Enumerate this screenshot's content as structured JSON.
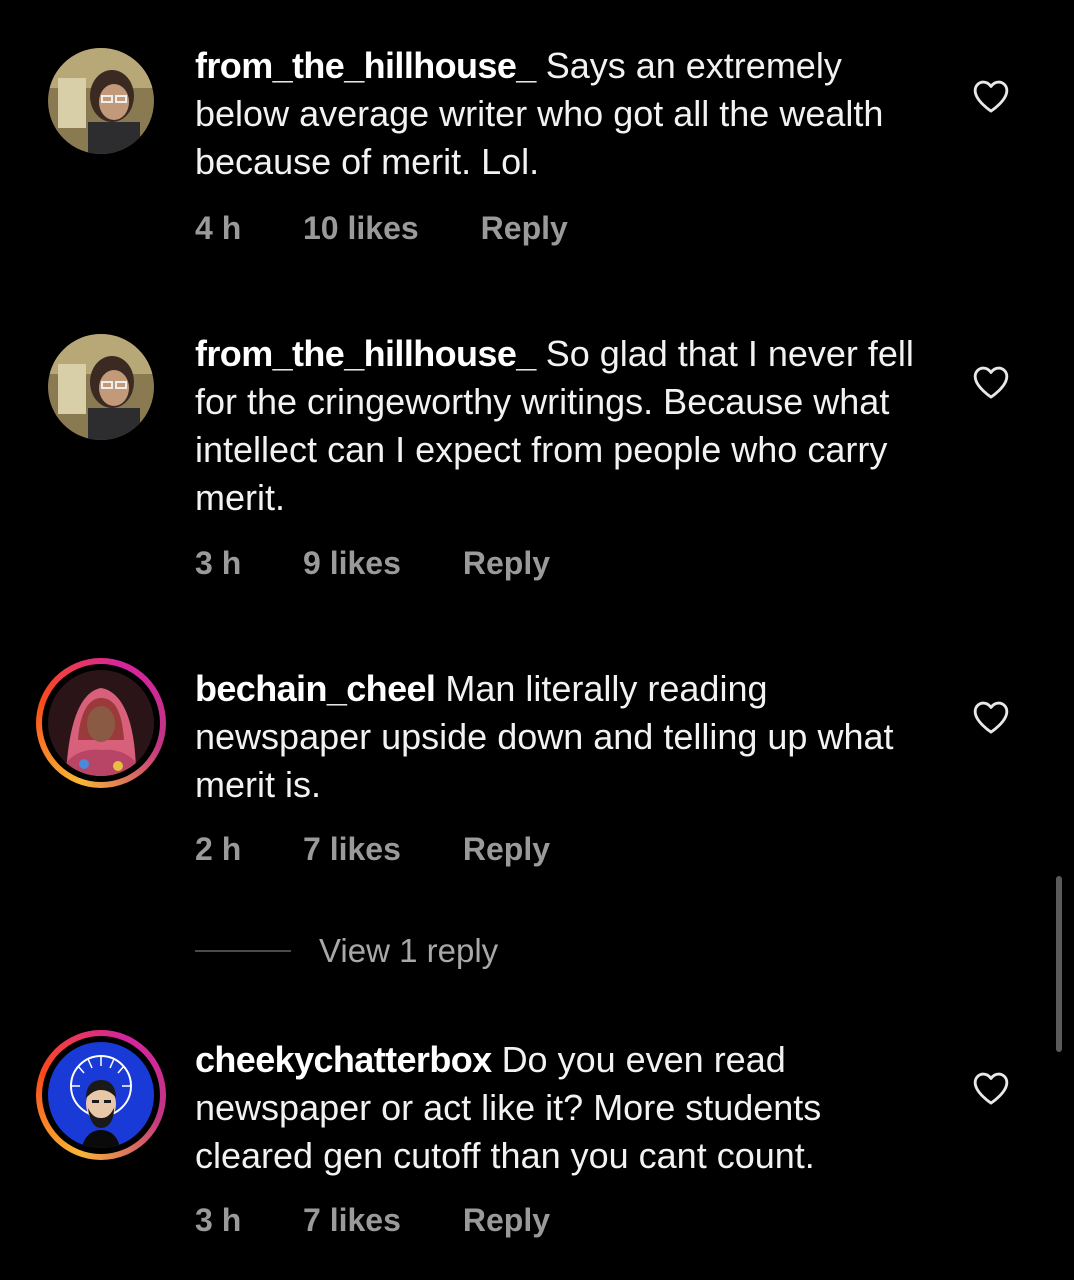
{
  "comments": [
    {
      "username": "from_the_hillhouse_",
      "text": "Says an extremely below average writer who got all the wealth because of merit. Lol.",
      "time": "4 h",
      "likes": "10 likes",
      "reply": "Reply",
      "has_story": false
    },
    {
      "username": "from_the_hillhouse_",
      "text": "So glad that I never fell for the cringeworthy writings. Because what intellect can I expect from people who carry merit.",
      "time": "3 h",
      "likes": "9 likes",
      "reply": "Reply",
      "has_story": false
    },
    {
      "username": "bechain_cheel",
      "text": "Man literally reading newspaper upside down and telling up what merit is.",
      "time": "2 h",
      "likes": "7 likes",
      "reply": "Reply",
      "has_story": true
    },
    {
      "username": "cheekychatterbox",
      "text": "Do you even read newspaper or act like it? More students cleared gen cutoff than you cant count.",
      "time": "3 h",
      "likes": "7 likes",
      "reply": "Reply",
      "has_story": true
    }
  ],
  "view_replies_label": "View 1 reply",
  "icons": {
    "like": "heart-outline-icon"
  },
  "colors": {
    "background": "#000000",
    "text": "#f2f2f2",
    "meta": "#9a9a9a",
    "story_ring": [
      "#f7b733",
      "#fc4a1a",
      "#d6249f"
    ]
  }
}
